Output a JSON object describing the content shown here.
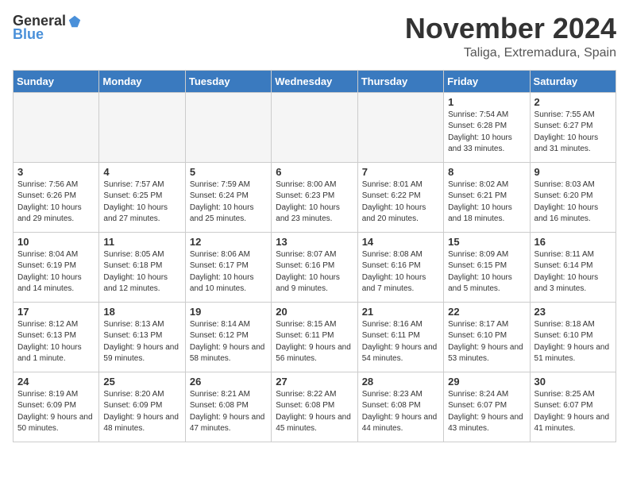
{
  "logo": {
    "general": "General",
    "blue": "Blue"
  },
  "title": "November 2024",
  "location": "Taliga, Extremadura, Spain",
  "days_of_week": [
    "Sunday",
    "Monday",
    "Tuesday",
    "Wednesday",
    "Thursday",
    "Friday",
    "Saturday"
  ],
  "weeks": [
    [
      {
        "day": "",
        "info": ""
      },
      {
        "day": "",
        "info": ""
      },
      {
        "day": "",
        "info": ""
      },
      {
        "day": "",
        "info": ""
      },
      {
        "day": "",
        "info": ""
      },
      {
        "day": "1",
        "info": "Sunrise: 7:54 AM\nSunset: 6:28 PM\nDaylight: 10 hours and 33 minutes."
      },
      {
        "day": "2",
        "info": "Sunrise: 7:55 AM\nSunset: 6:27 PM\nDaylight: 10 hours and 31 minutes."
      }
    ],
    [
      {
        "day": "3",
        "info": "Sunrise: 7:56 AM\nSunset: 6:26 PM\nDaylight: 10 hours and 29 minutes."
      },
      {
        "day": "4",
        "info": "Sunrise: 7:57 AM\nSunset: 6:25 PM\nDaylight: 10 hours and 27 minutes."
      },
      {
        "day": "5",
        "info": "Sunrise: 7:59 AM\nSunset: 6:24 PM\nDaylight: 10 hours and 25 minutes."
      },
      {
        "day": "6",
        "info": "Sunrise: 8:00 AM\nSunset: 6:23 PM\nDaylight: 10 hours and 23 minutes."
      },
      {
        "day": "7",
        "info": "Sunrise: 8:01 AM\nSunset: 6:22 PM\nDaylight: 10 hours and 20 minutes."
      },
      {
        "day": "8",
        "info": "Sunrise: 8:02 AM\nSunset: 6:21 PM\nDaylight: 10 hours and 18 minutes."
      },
      {
        "day": "9",
        "info": "Sunrise: 8:03 AM\nSunset: 6:20 PM\nDaylight: 10 hours and 16 minutes."
      }
    ],
    [
      {
        "day": "10",
        "info": "Sunrise: 8:04 AM\nSunset: 6:19 PM\nDaylight: 10 hours and 14 minutes."
      },
      {
        "day": "11",
        "info": "Sunrise: 8:05 AM\nSunset: 6:18 PM\nDaylight: 10 hours and 12 minutes."
      },
      {
        "day": "12",
        "info": "Sunrise: 8:06 AM\nSunset: 6:17 PM\nDaylight: 10 hours and 10 minutes."
      },
      {
        "day": "13",
        "info": "Sunrise: 8:07 AM\nSunset: 6:16 PM\nDaylight: 10 hours and 9 minutes."
      },
      {
        "day": "14",
        "info": "Sunrise: 8:08 AM\nSunset: 6:16 PM\nDaylight: 10 hours and 7 minutes."
      },
      {
        "day": "15",
        "info": "Sunrise: 8:09 AM\nSunset: 6:15 PM\nDaylight: 10 hours and 5 minutes."
      },
      {
        "day": "16",
        "info": "Sunrise: 8:11 AM\nSunset: 6:14 PM\nDaylight: 10 hours and 3 minutes."
      }
    ],
    [
      {
        "day": "17",
        "info": "Sunrise: 8:12 AM\nSunset: 6:13 PM\nDaylight: 10 hours and 1 minute."
      },
      {
        "day": "18",
        "info": "Sunrise: 8:13 AM\nSunset: 6:13 PM\nDaylight: 9 hours and 59 minutes."
      },
      {
        "day": "19",
        "info": "Sunrise: 8:14 AM\nSunset: 6:12 PM\nDaylight: 9 hours and 58 minutes."
      },
      {
        "day": "20",
        "info": "Sunrise: 8:15 AM\nSunset: 6:11 PM\nDaylight: 9 hours and 56 minutes."
      },
      {
        "day": "21",
        "info": "Sunrise: 8:16 AM\nSunset: 6:11 PM\nDaylight: 9 hours and 54 minutes."
      },
      {
        "day": "22",
        "info": "Sunrise: 8:17 AM\nSunset: 6:10 PM\nDaylight: 9 hours and 53 minutes."
      },
      {
        "day": "23",
        "info": "Sunrise: 8:18 AM\nSunset: 6:10 PM\nDaylight: 9 hours and 51 minutes."
      }
    ],
    [
      {
        "day": "24",
        "info": "Sunrise: 8:19 AM\nSunset: 6:09 PM\nDaylight: 9 hours and 50 minutes."
      },
      {
        "day": "25",
        "info": "Sunrise: 8:20 AM\nSunset: 6:09 PM\nDaylight: 9 hours and 48 minutes."
      },
      {
        "day": "26",
        "info": "Sunrise: 8:21 AM\nSunset: 6:08 PM\nDaylight: 9 hours and 47 minutes."
      },
      {
        "day": "27",
        "info": "Sunrise: 8:22 AM\nSunset: 6:08 PM\nDaylight: 9 hours and 45 minutes."
      },
      {
        "day": "28",
        "info": "Sunrise: 8:23 AM\nSunset: 6:08 PM\nDaylight: 9 hours and 44 minutes."
      },
      {
        "day": "29",
        "info": "Sunrise: 8:24 AM\nSunset: 6:07 PM\nDaylight: 9 hours and 43 minutes."
      },
      {
        "day": "30",
        "info": "Sunrise: 8:25 AM\nSunset: 6:07 PM\nDaylight: 9 hours and 41 minutes."
      }
    ]
  ]
}
